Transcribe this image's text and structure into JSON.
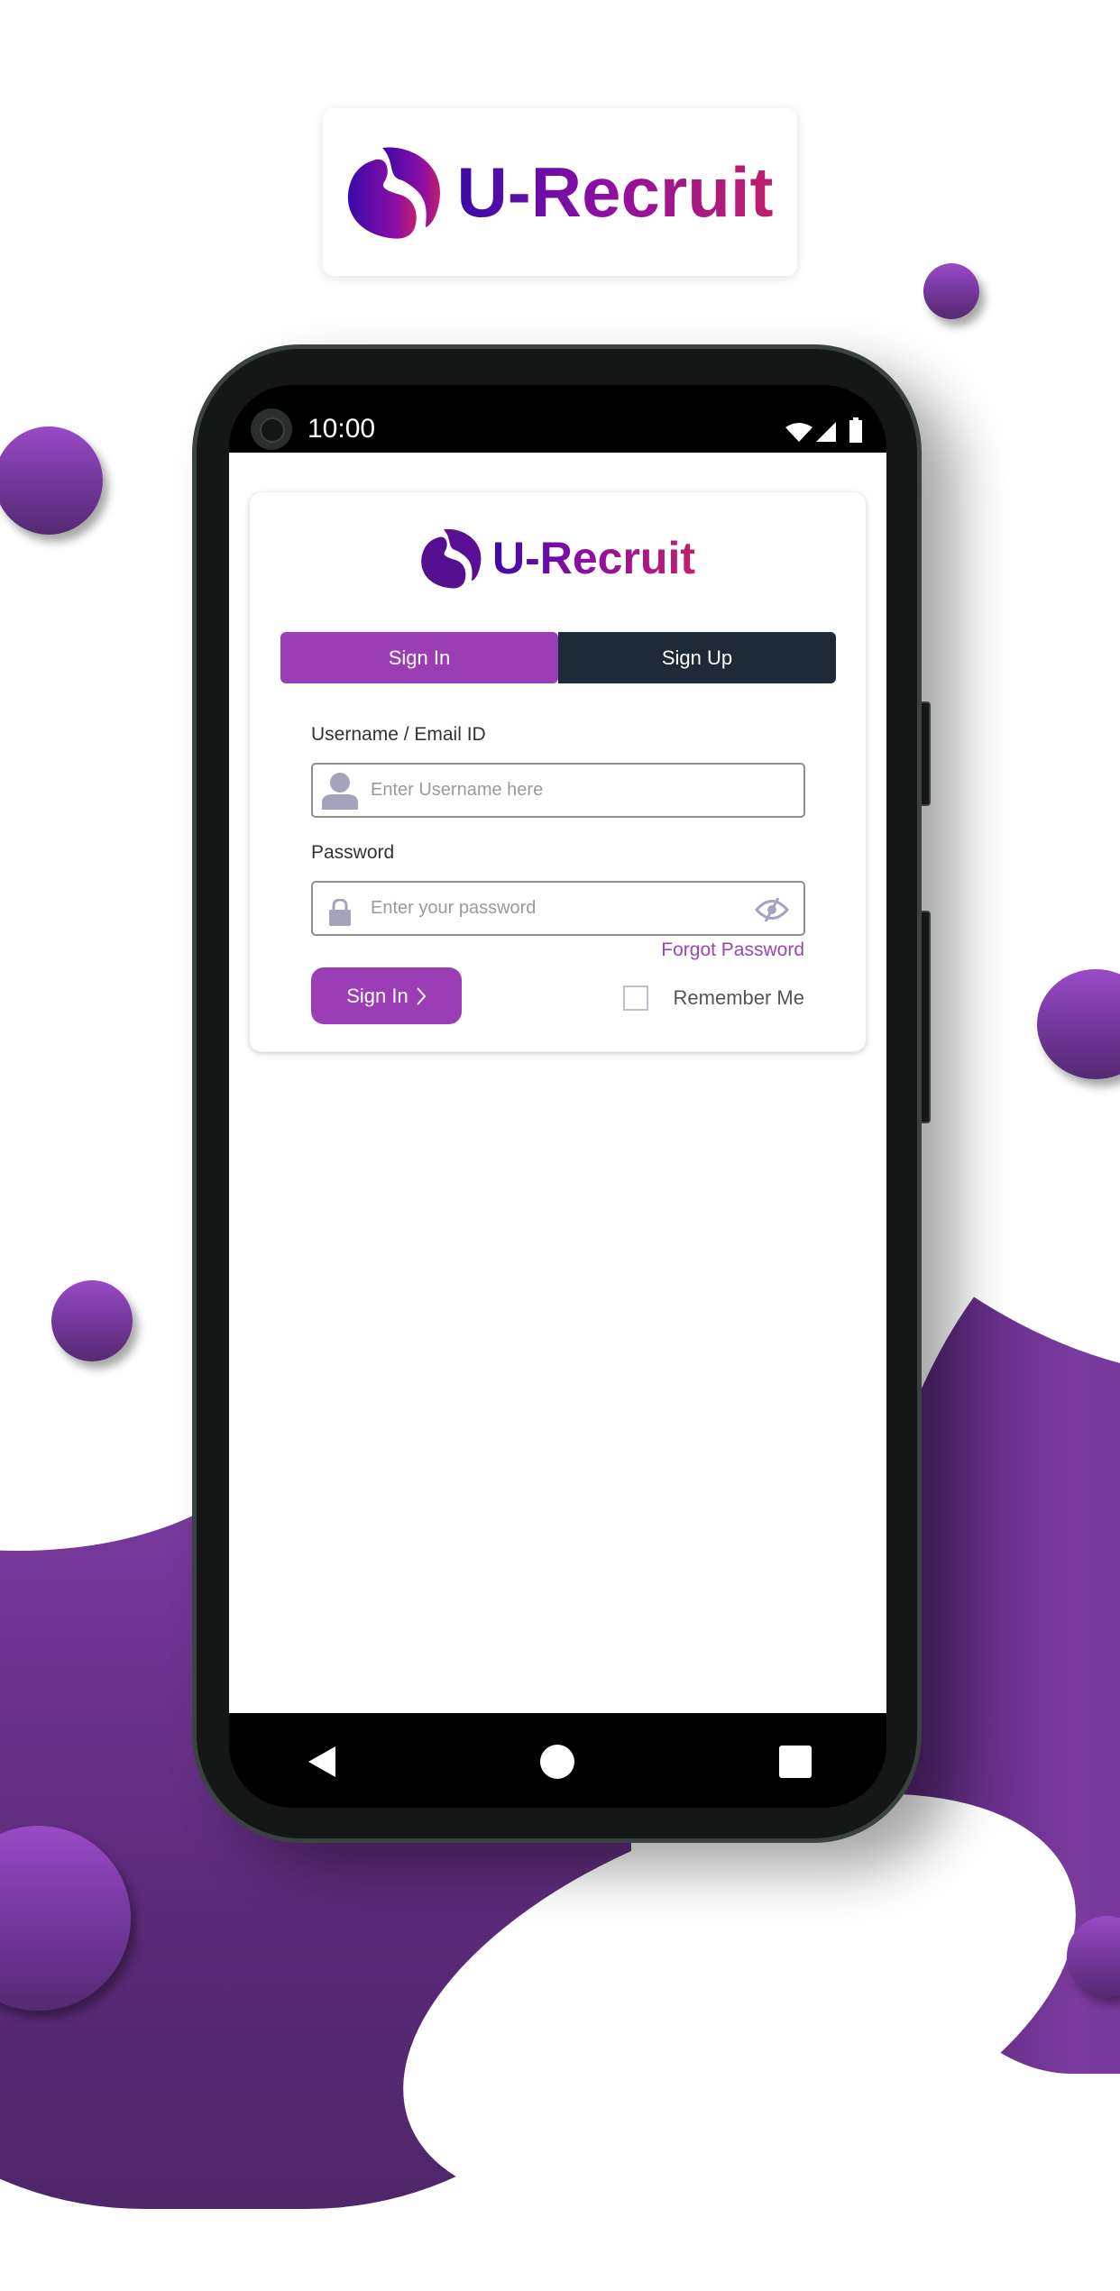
{
  "brand": {
    "name": "U-Recruit",
    "gradient_start": "#3a0aa8",
    "gradient_mid": "#8d0ea4",
    "gradient_end": "#c0206a"
  },
  "status_bar": {
    "time": "10:00",
    "icons": [
      "wifi-icon",
      "cellular-signal-icon",
      "battery-icon"
    ]
  },
  "login": {
    "tabs": [
      {
        "label": "Sign In",
        "active": true
      },
      {
        "label": "Sign Up",
        "active": false
      }
    ],
    "username": {
      "label": "Username / Email ID",
      "value": "",
      "placeholder": "Enter Username here",
      "icon": "user-icon"
    },
    "password": {
      "label": "Password",
      "value": "",
      "placeholder": "Enter your password",
      "icon": "lock-icon",
      "toggle_icon": "eye-slash-icon"
    },
    "forgot_password": "Forgot Password",
    "submit_label": "Sign In",
    "submit_icon": "chevron-right-icon",
    "remember_me": {
      "label": "Remember Me",
      "checked": false
    }
  },
  "nav_bar": {
    "buttons": [
      "back-icon",
      "home-icon",
      "recents-icon"
    ]
  },
  "colors": {
    "accent": "#9b3db5",
    "tab_inactive": "#1f2a38",
    "background_blob": "#5f2c80"
  }
}
